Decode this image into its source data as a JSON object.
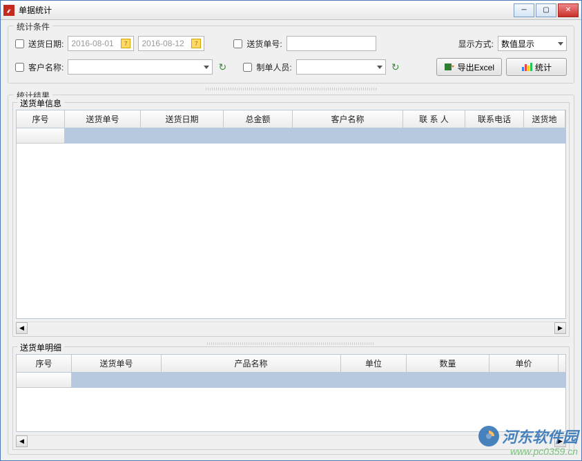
{
  "window": {
    "title": "单据统计"
  },
  "conditions": {
    "group_title": "统计条件",
    "delivery_date_label": "送货日期:",
    "date_from": "2016-08-01",
    "date_to": "2016-08-12",
    "delivery_no_label": "送货单号:",
    "display_mode_label": "显示方式:",
    "display_mode_value": "数值显示",
    "customer_label": "客户名称:",
    "creator_label": "制单人员:",
    "export_label": "导出Excel",
    "stats_label": "统计"
  },
  "results": {
    "group_title": "统计结果",
    "panel1_title": "送货单信息",
    "panel2_title": "送货单明细",
    "table1_headers": [
      "序号",
      "送货单号",
      "送货日期",
      "总金额",
      "客户名称",
      "联 系 人",
      "联系电话",
      "送货地"
    ],
    "table1_widths": [
      70,
      110,
      120,
      100,
      160,
      90,
      85,
      60
    ],
    "table2_headers": [
      "序号",
      "送货单号",
      "产品名称",
      "单位",
      "数量",
      "单价"
    ],
    "table2_widths": [
      80,
      130,
      260,
      95,
      120,
      100
    ]
  },
  "watermark": {
    "line1": "河东软件园",
    "line2": "www.pc0359.cn"
  }
}
